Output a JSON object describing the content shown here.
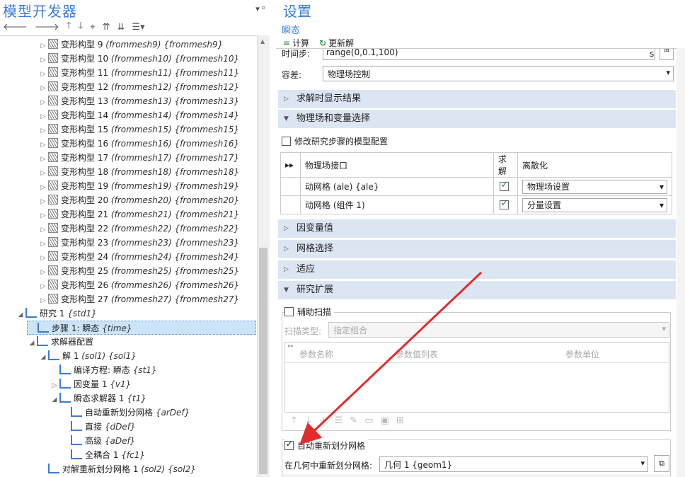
{
  "left_panel": {
    "title": "模型开发器",
    "pin": "▾ ᵖ",
    "toolbar": [
      "🡐",
      "🡒",
      "🡑",
      "🡓",
      "⌖",
      "⇈",
      "⇊",
      "☰▾"
    ],
    "tree": [
      {
        "indent": 4,
        "toggle": "▷",
        "icon": "mesh-icon",
        "label": "变形构型 9",
        "tag": "(frommesh9) {frommesh9}"
      },
      {
        "indent": 4,
        "toggle": "▷",
        "icon": "mesh-icon",
        "label": "变形构型 10",
        "tag": "(frommesh10) {frommesh10}"
      },
      {
        "indent": 4,
        "toggle": "▷",
        "icon": "mesh-icon",
        "label": "变形构型 11",
        "tag": "(frommesh11) {frommesh11}"
      },
      {
        "indent": 4,
        "toggle": "▷",
        "icon": "mesh-icon",
        "label": "变形构型 12",
        "tag": "(frommesh12) {frommesh12}"
      },
      {
        "indent": 4,
        "toggle": "▷",
        "icon": "mesh-icon",
        "label": "变形构型 13",
        "tag": "(frommesh13) {frommesh13}"
      },
      {
        "indent": 4,
        "toggle": "▷",
        "icon": "mesh-icon",
        "label": "变形构型 14",
        "tag": "(frommesh14) {frommesh14}"
      },
      {
        "indent": 4,
        "toggle": "▷",
        "icon": "mesh-icon",
        "label": "变形构型 15",
        "tag": "(frommesh15) {frommesh15}"
      },
      {
        "indent": 4,
        "toggle": "▷",
        "icon": "mesh-icon",
        "label": "变形构型 16",
        "tag": "(frommesh16) {frommesh16}"
      },
      {
        "indent": 4,
        "toggle": "▷",
        "icon": "mesh-icon",
        "label": "变形构型 17",
        "tag": "(frommesh17) {frommesh17}"
      },
      {
        "indent": 4,
        "toggle": "▷",
        "icon": "mesh-icon",
        "label": "变形构型 18",
        "tag": "(frommesh18) {frommesh18}"
      },
      {
        "indent": 4,
        "toggle": "▷",
        "icon": "mesh-icon",
        "label": "变形构型 19",
        "tag": "(frommesh19) {frommesh19}"
      },
      {
        "indent": 4,
        "toggle": "▷",
        "icon": "mesh-icon",
        "label": "变形构型 20",
        "tag": "(frommesh20) {frommesh20}"
      },
      {
        "indent": 4,
        "toggle": "▷",
        "icon": "mesh-icon",
        "label": "变形构型 21",
        "tag": "(frommesh21) {frommesh21}"
      },
      {
        "indent": 4,
        "toggle": "▷",
        "icon": "mesh-icon",
        "label": "变形构型 22",
        "tag": "(frommesh22) {frommesh22}"
      },
      {
        "indent": 4,
        "toggle": "▷",
        "icon": "mesh-icon",
        "label": "变形构型 23",
        "tag": "(frommesh23) {frommesh23}"
      },
      {
        "indent": 4,
        "toggle": "▷",
        "icon": "mesh-icon",
        "label": "变形构型 24",
        "tag": "(frommesh24) {frommesh24}"
      },
      {
        "indent": 4,
        "toggle": "▷",
        "icon": "mesh-icon",
        "label": "变形构型 25",
        "tag": "(frommesh25) {frommesh25}"
      },
      {
        "indent": 4,
        "toggle": "▷",
        "icon": "mesh-icon",
        "label": "变形构型 26",
        "tag": "(frommesh26) {frommesh26}"
      },
      {
        "indent": 4,
        "toggle": "▷",
        "icon": "mesh-icon",
        "label": "变形构型 27",
        "tag": "(frommesh27) {frommesh27}"
      },
      {
        "indent": 2,
        "toggle": "◢",
        "icon": "study-icon",
        "label": "研究 1",
        "tag": "{std1}"
      },
      {
        "indent": 3,
        "toggle": "",
        "icon": "step-icon",
        "label": "步骤 1: 瞬态",
        "tag": "{time}",
        "selected": true
      },
      {
        "indent": 3,
        "toggle": "◢",
        "icon": "solver-config-icon",
        "label": "求解器配置",
        "tag": ""
      },
      {
        "indent": 4,
        "toggle": "◢",
        "icon": "solution-icon",
        "label": "解 1",
        "tag": "(sol1) {sol1}"
      },
      {
        "indent": 5,
        "toggle": "",
        "icon": "compile-icon",
        "label": "编译方程: 瞬态",
        "tag": "{st1}"
      },
      {
        "indent": 5,
        "toggle": "▷",
        "icon": "variable-icon",
        "label": "因变量 1",
        "tag": "{v1}"
      },
      {
        "indent": 5,
        "toggle": "◢",
        "icon": "time-solver-icon",
        "label": "瞬态求解器 1",
        "tag": "{t1}"
      },
      {
        "indent": 6,
        "toggle": "",
        "icon": "remesh-icon",
        "label": "自动重新划分网格",
        "tag": "{arDef}"
      },
      {
        "indent": 6,
        "toggle": "",
        "icon": "direct-icon",
        "label": "直接",
        "tag": "{dDef}"
      },
      {
        "indent": 6,
        "toggle": "",
        "icon": "advanced-icon",
        "label": "高级",
        "tag": "{aDef}"
      },
      {
        "indent": 6,
        "toggle": "",
        "icon": "coupled-icon",
        "label": "全耦合 1",
        "tag": "{fc1}"
      },
      {
        "indent": 4,
        "toggle": "",
        "icon": "solution-icon",
        "label": "对解重新划分网格 1",
        "tag": "(sol2) {sol2}"
      }
    ]
  },
  "right_panel": {
    "title": "设置",
    "subtitle": "瞬态",
    "compute_label": "计算",
    "update_label": "更新解",
    "time_step_label": "时间步:",
    "time_step_value": "range(0,0.1,100)",
    "time_unit": "s",
    "tolerance_label": "容差:",
    "tolerance_value": "物理场控制",
    "sec_results": "求解时显示结果",
    "sec_physics": "物理场和变量选择",
    "modify_config_label": "修改研究步骤的模型配置",
    "phys_cols": [
      "物理场接口",
      "求解",
      "离散化"
    ],
    "phys_rows": [
      {
        "name": "动网格 (ale) {ale}",
        "disc": "物理场设置"
      },
      {
        "name": "动网格 (组件 1)",
        "disc": "分量设置"
      }
    ],
    "sec_dep": "因变量值",
    "sec_mesh": "网格选择",
    "sec_adapt": "适应",
    "sec_ext": "研究扩展",
    "aux_sweep_label": "辅助扫描",
    "sweep_type_label": "扫描类型:",
    "sweep_type_value": "指定组合",
    "param_cols": [
      "参数名称",
      "参数值列表",
      "参数单位"
    ],
    "auto_remesh_label": "自动重新划分网格",
    "remesh_geom_label": "在几何中重新划分网格:",
    "remesh_geom_value": "几何 1 {geom1}"
  }
}
